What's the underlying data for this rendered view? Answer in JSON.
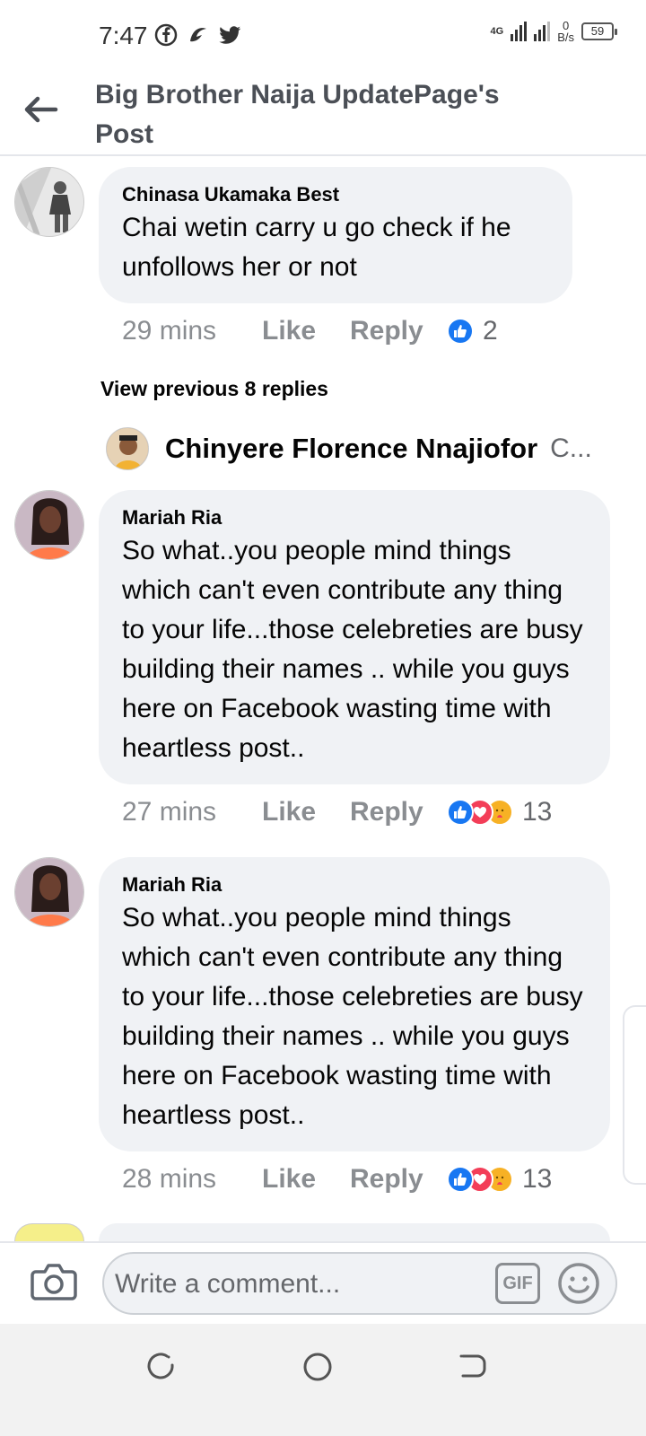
{
  "status_bar": {
    "time": "7:47",
    "network": "4G",
    "speed_value": "0",
    "speed_unit": "B/s",
    "battery": "59"
  },
  "header": {
    "title": "Big Brother Naija UpdatePage's Post"
  },
  "comments": [
    {
      "author": "Chinasa Ukamaka Best",
      "text": "Chai wetin carry u go check if he unfollows her or not",
      "time": "29 mins",
      "like": "Like",
      "reply": "Reply",
      "reaction_count": "2",
      "reactions": [
        "like-icon"
      ]
    },
    {
      "author": "Mariah Ria",
      "text": "So what..you people mind things which can't even contribute any thing to your life...those celebreties are busy building their names .. while you guys here on Facebook wasting time with heartless post..",
      "time": "27 mins",
      "like": "Like",
      "reply": "Reply",
      "reaction_count": "13",
      "reactions": [
        "like-icon",
        "love-icon",
        "care-icon"
      ]
    },
    {
      "author": "Mariah Ria",
      "text": "So what..you people mind things which can't even contribute any thing to your life...those celebreties are busy building their names .. while you guys here on Facebook wasting time with heartless post..",
      "time": "28 mins",
      "like": "Like",
      "reply": "Reply",
      "reaction_count": "13",
      "reactions": [
        "like-icon",
        "love-icon",
        "care-icon"
      ]
    }
  ],
  "thread": {
    "view_previous": "View previous 8 replies",
    "reply_preview_name": "Chinyere Florence Nnajiofor",
    "reply_preview_snippet": "C..."
  },
  "composer": {
    "placeholder": "Write a comment...",
    "gif_label": "GIF"
  },
  "colors": {
    "bubble": "#f0f2f5",
    "like_blue": "#1877f2",
    "love_red": "#f33e58",
    "care_yellow": "#f7b125",
    "meta_grey": "#8a8d91"
  }
}
